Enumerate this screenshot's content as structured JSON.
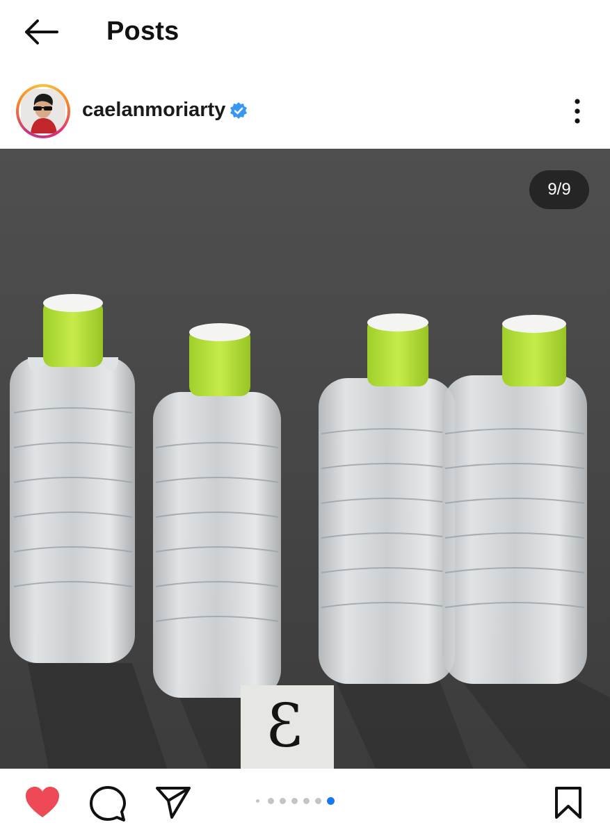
{
  "header": {
    "title": "Posts",
    "back_icon": "arrow-left-icon"
  },
  "post": {
    "username": "caelanmoriarty",
    "verified": true,
    "verified_color": "#3897f0",
    "more_icon": "more-vertical-icon",
    "media": {
      "counter": "9/9",
      "description_icons": [
        "water-bottle"
      ],
      "placard_text": "3"
    },
    "carousel": {
      "total": 7,
      "active_index": 6,
      "active_color": "#1877f2"
    },
    "actions": {
      "like_icon": "heart-filled-icon",
      "like_color": "#ed4956",
      "comment_icon": "comment-icon",
      "share_icon": "send-icon",
      "save_icon": "bookmark-icon"
    }
  }
}
